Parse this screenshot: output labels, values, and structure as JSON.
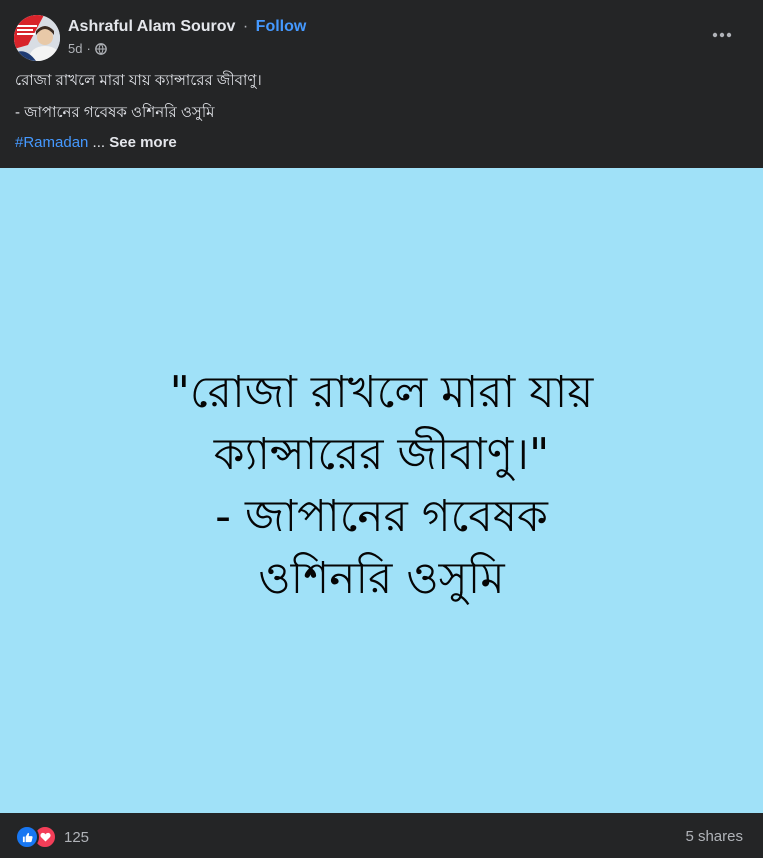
{
  "post": {
    "author_name": "Ashraful Alam Sourov",
    "separator": "·",
    "follow_label": "Follow",
    "time_ago": "5d",
    "time_separator": "·",
    "privacy_icon": "globe-icon",
    "more_icon": "more-horizontal-icon",
    "caption": {
      "line1": "রোজা রাখলে মারা যায় ক্যান্সারের জীবাণু।",
      "line2": "- জাপানের গবেষক ওশিনরি ওসুমি",
      "hashtag": "#Ramadan",
      "ellipsis": " ... ",
      "see_more": "See more"
    },
    "image": {
      "background_color": "#a0e1f8",
      "lines": [
        "\"রোজা রাখলে মারা যায়",
        "ক্যান্সারের জীবাণু।\"",
        "- জাপানের গবেষক",
        "ওশিনরি ওসুমি"
      ]
    },
    "footer": {
      "reaction_icons": [
        "like-icon",
        "love-icon"
      ],
      "reaction_count": "125",
      "shares": "5 shares"
    }
  },
  "colors": {
    "background": "#242526",
    "text": "#e4e6eb",
    "secondary_text": "#b0b3b8",
    "link": "#4599ff",
    "like": "#1877f2",
    "love": "#f33e58"
  }
}
